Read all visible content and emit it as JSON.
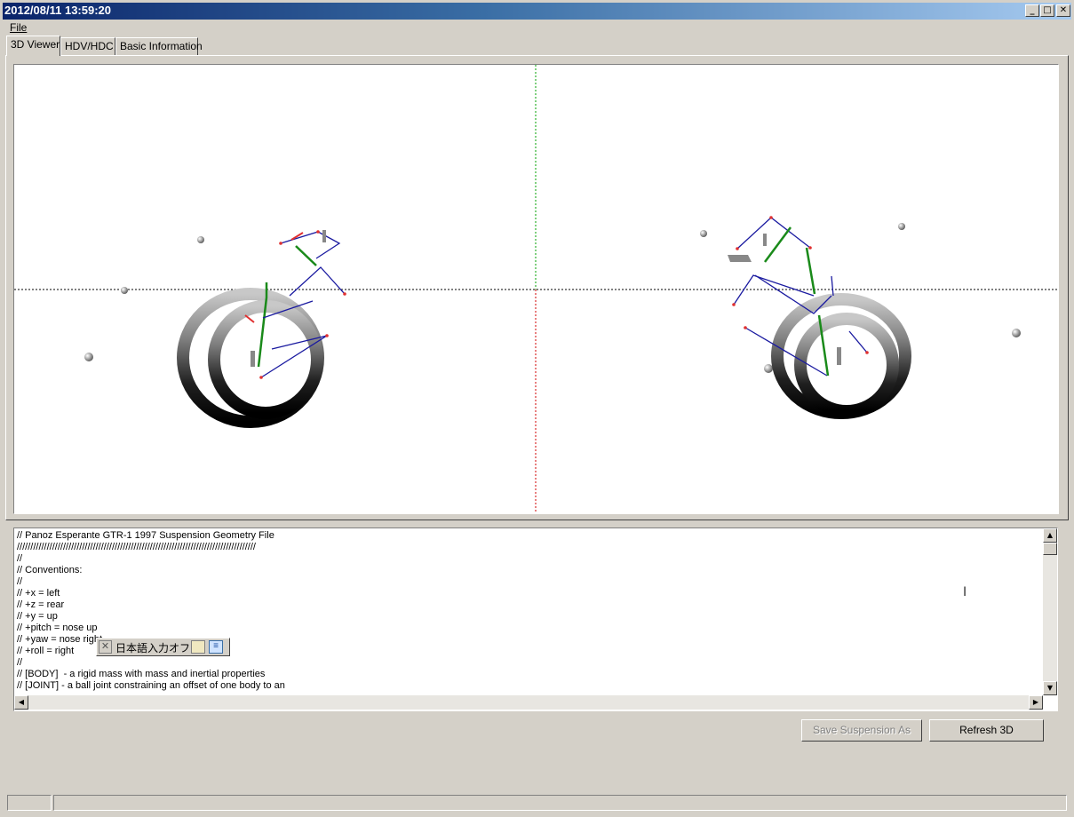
{
  "window": {
    "title": "2012/08/11 13:59:20",
    "minimize_glyph": "_",
    "maximize_glyph": "□",
    "close_glyph": "✕"
  },
  "menu": {
    "file": "File"
  },
  "tabs": [
    "3D Viewer",
    "HDV/HDC",
    "Basic Information"
  ],
  "editor": {
    "lines": [
      "// Panoz Esperante GTR-1 1997 Suspension Geometry File",
      "////////////////////////////////////////////////////////////////////////////////////////",
      "//",
      "// Conventions:",
      "//",
      "// +x = left",
      "// +z = rear",
      "// +y = up",
      "// +pitch = nose up",
      "// +yaw = nose right",
      "// +roll = right",
      "//",
      "// [BODY]  - a rigid mass with mass and inertial properties",
      "// [JOINT] - a ball joint constraining an offset of one body to an"
    ]
  },
  "ime": {
    "label": "日本語入力オフ"
  },
  "buttons": {
    "save_suspension": "Save Suspension As",
    "refresh_3d": "Refresh 3D"
  },
  "colors": {
    "title_start": "#0a246a",
    "title_end": "#a6caf0",
    "face": "#d4d0c8",
    "link_blue": "#1a1aa0",
    "link_green": "#1a8a1a",
    "joint_red": "#e03030"
  }
}
